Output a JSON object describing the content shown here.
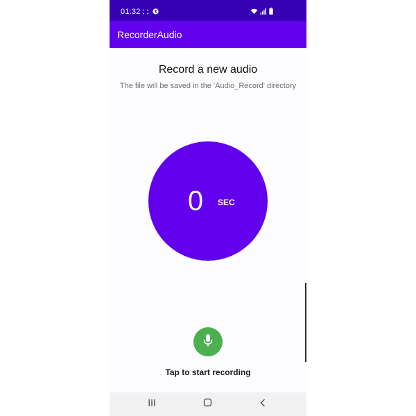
{
  "status_bar": {
    "time": "01:32",
    "icons": [
      "notification-dots-icon",
      "account-circle-icon",
      "wifi-icon",
      "signal-icon",
      "battery-icon"
    ]
  },
  "app_bar": {
    "title": "RecorderAudio"
  },
  "main": {
    "heading": "Record a new audio",
    "subheading": "The file will be saved in the 'Audio_Record' directory",
    "timer": {
      "value": "0",
      "unit": "SEC"
    },
    "mic_button_icon": "microphone-icon",
    "hint": "Tap to start recording"
  },
  "nav_bar": {
    "icons": [
      "recent-apps-icon",
      "home-icon",
      "back-icon"
    ]
  },
  "colors": {
    "status_bar": "#3700b3",
    "app_bar": "#6200ee",
    "timer_circle": "#6200ee",
    "mic_button": "#4caf50",
    "nav_bar": "#f1f1f1"
  }
}
